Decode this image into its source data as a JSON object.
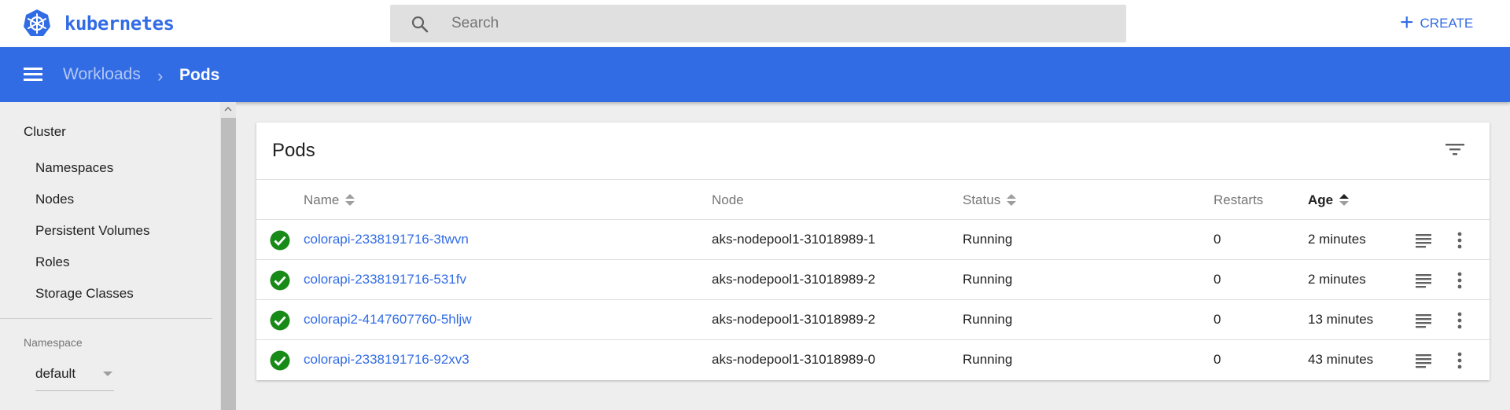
{
  "brand": {
    "name": "kubernetes",
    "logo_icon": "kubernetes-wheel-icon",
    "color": "#326ce5"
  },
  "search": {
    "placeholder": "Search",
    "value": ""
  },
  "create": {
    "label": "CREATE"
  },
  "breadcrumb": {
    "parent": "Workloads",
    "separator": "›",
    "current": "Pods"
  },
  "sidebar": {
    "section_title": "Cluster",
    "items": [
      {
        "label": "Namespaces"
      },
      {
        "label": "Nodes"
      },
      {
        "label": "Persistent Volumes"
      },
      {
        "label": "Roles"
      },
      {
        "label": "Storage Classes"
      }
    ],
    "namespace_label": "Namespace",
    "namespace_value": "default"
  },
  "card": {
    "title": "Pods",
    "columns": {
      "name": "Name",
      "node": "Node",
      "status": "Status",
      "restarts": "Restarts",
      "age": "Age"
    },
    "rows": [
      {
        "name": "colorapi-2338191716-3twvn",
        "node": "aks-nodepool1-31018989-1",
        "status": "Running",
        "restarts": "0",
        "age": "2 minutes"
      },
      {
        "name": "colorapi-2338191716-531fv",
        "node": "aks-nodepool1-31018989-2",
        "status": "Running",
        "restarts": "0",
        "age": "2 minutes"
      },
      {
        "name": "colorapi2-4147607760-5hljw",
        "node": "aks-nodepool1-31018989-2",
        "status": "Running",
        "restarts": "0",
        "age": "13 minutes"
      },
      {
        "name": "colorapi-2338191716-92xv3",
        "node": "aks-nodepool1-31018989-0",
        "status": "Running",
        "restarts": "0",
        "age": "43 minutes"
      }
    ]
  },
  "colors": {
    "header": "#326ce5",
    "success": "#188a18",
    "link": "#326ce5"
  }
}
